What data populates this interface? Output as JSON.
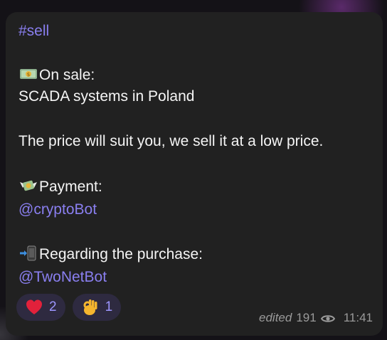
{
  "message": {
    "hashtag": "#sell",
    "on_sale_label": "On sale:",
    "on_sale_value": "SCADA systems in Poland",
    "price_text": "The price will suit you, we sell it at a low price.",
    "payment_label": "Payment:",
    "payment_link": "@cryptoBot",
    "purchase_label": "Regarding the purchase:",
    "purchase_link": "@TwoNetBot"
  },
  "reactions": [
    {
      "icon": "heart-icon",
      "count": "2"
    },
    {
      "icon": "ok-hand-icon",
      "count": "1"
    }
  ],
  "meta": {
    "edited": "edited",
    "views": "191",
    "time": "11:41"
  },
  "colors": {
    "bubble": "#212121",
    "link": "#8a7ff0",
    "reaction_bg": "#2e2a40",
    "reaction_text": "#9d96ff"
  }
}
